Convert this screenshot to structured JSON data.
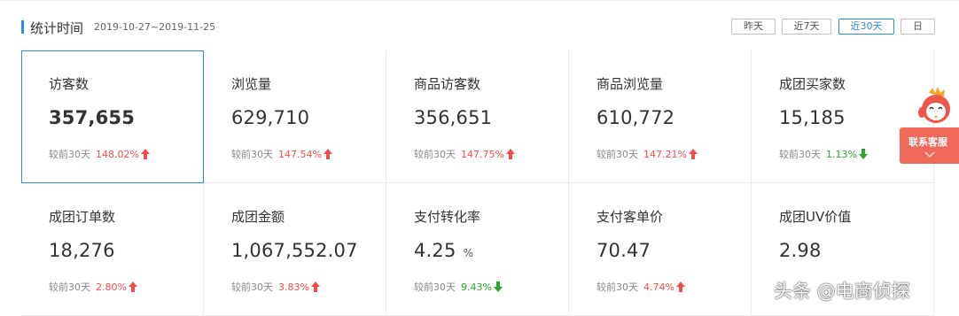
{
  "header": {
    "title": "统计时间",
    "date_range": "2019-10-27~2019-11-25",
    "range_buttons": [
      "昨天",
      "近7天",
      "近30天",
      "日"
    ],
    "active_range": "近30天"
  },
  "metrics": [
    {
      "label": "访客数",
      "value": "357,655",
      "compare_text": "较前30天",
      "change": "148.02%",
      "trend": "up"
    },
    {
      "label": "浏览量",
      "value": "629,710",
      "compare_text": "较前30天",
      "change": "147.54%",
      "trend": "up"
    },
    {
      "label": "商品访客数",
      "value": "356,651",
      "compare_text": "较前30天",
      "change": "147.75%",
      "trend": "up"
    },
    {
      "label": "商品浏览量",
      "value": "610,772",
      "compare_text": "较前30天",
      "change": "147.21%",
      "trend": "up"
    },
    {
      "label": "成团买家数",
      "value": "15,185",
      "compare_text": "较前30天",
      "change": "1.13%",
      "trend": "down"
    },
    {
      "label": "成团订单数",
      "value": "18,276",
      "compare_text": "较前30天",
      "change": "2.80%",
      "trend": "up"
    },
    {
      "label": "成团金额",
      "value": "1,067,552.07",
      "compare_text": "较前30天",
      "change": "3.83%",
      "trend": "up"
    },
    {
      "label": "支付转化率",
      "value": "4.25",
      "unit": "%",
      "compare_text": "较前30天",
      "change": "9.43%",
      "trend": "down"
    },
    {
      "label": "支付客单价",
      "value": "70.47",
      "compare_text": "较前30天",
      "change": "4.74%",
      "trend": "up"
    },
    {
      "label": "成团UV价值",
      "value": "2.98",
      "compare_text": "",
      "change": "",
      "trend": ""
    }
  ],
  "selected_metric": "访客数",
  "customer_service": {
    "label": "联系客服"
  },
  "watermark": "头条 @电商侦探",
  "colors": {
    "accent": "#2d8cf0",
    "up": "#f04e4e",
    "down": "#2aa52a",
    "service": "#f06a5a"
  }
}
